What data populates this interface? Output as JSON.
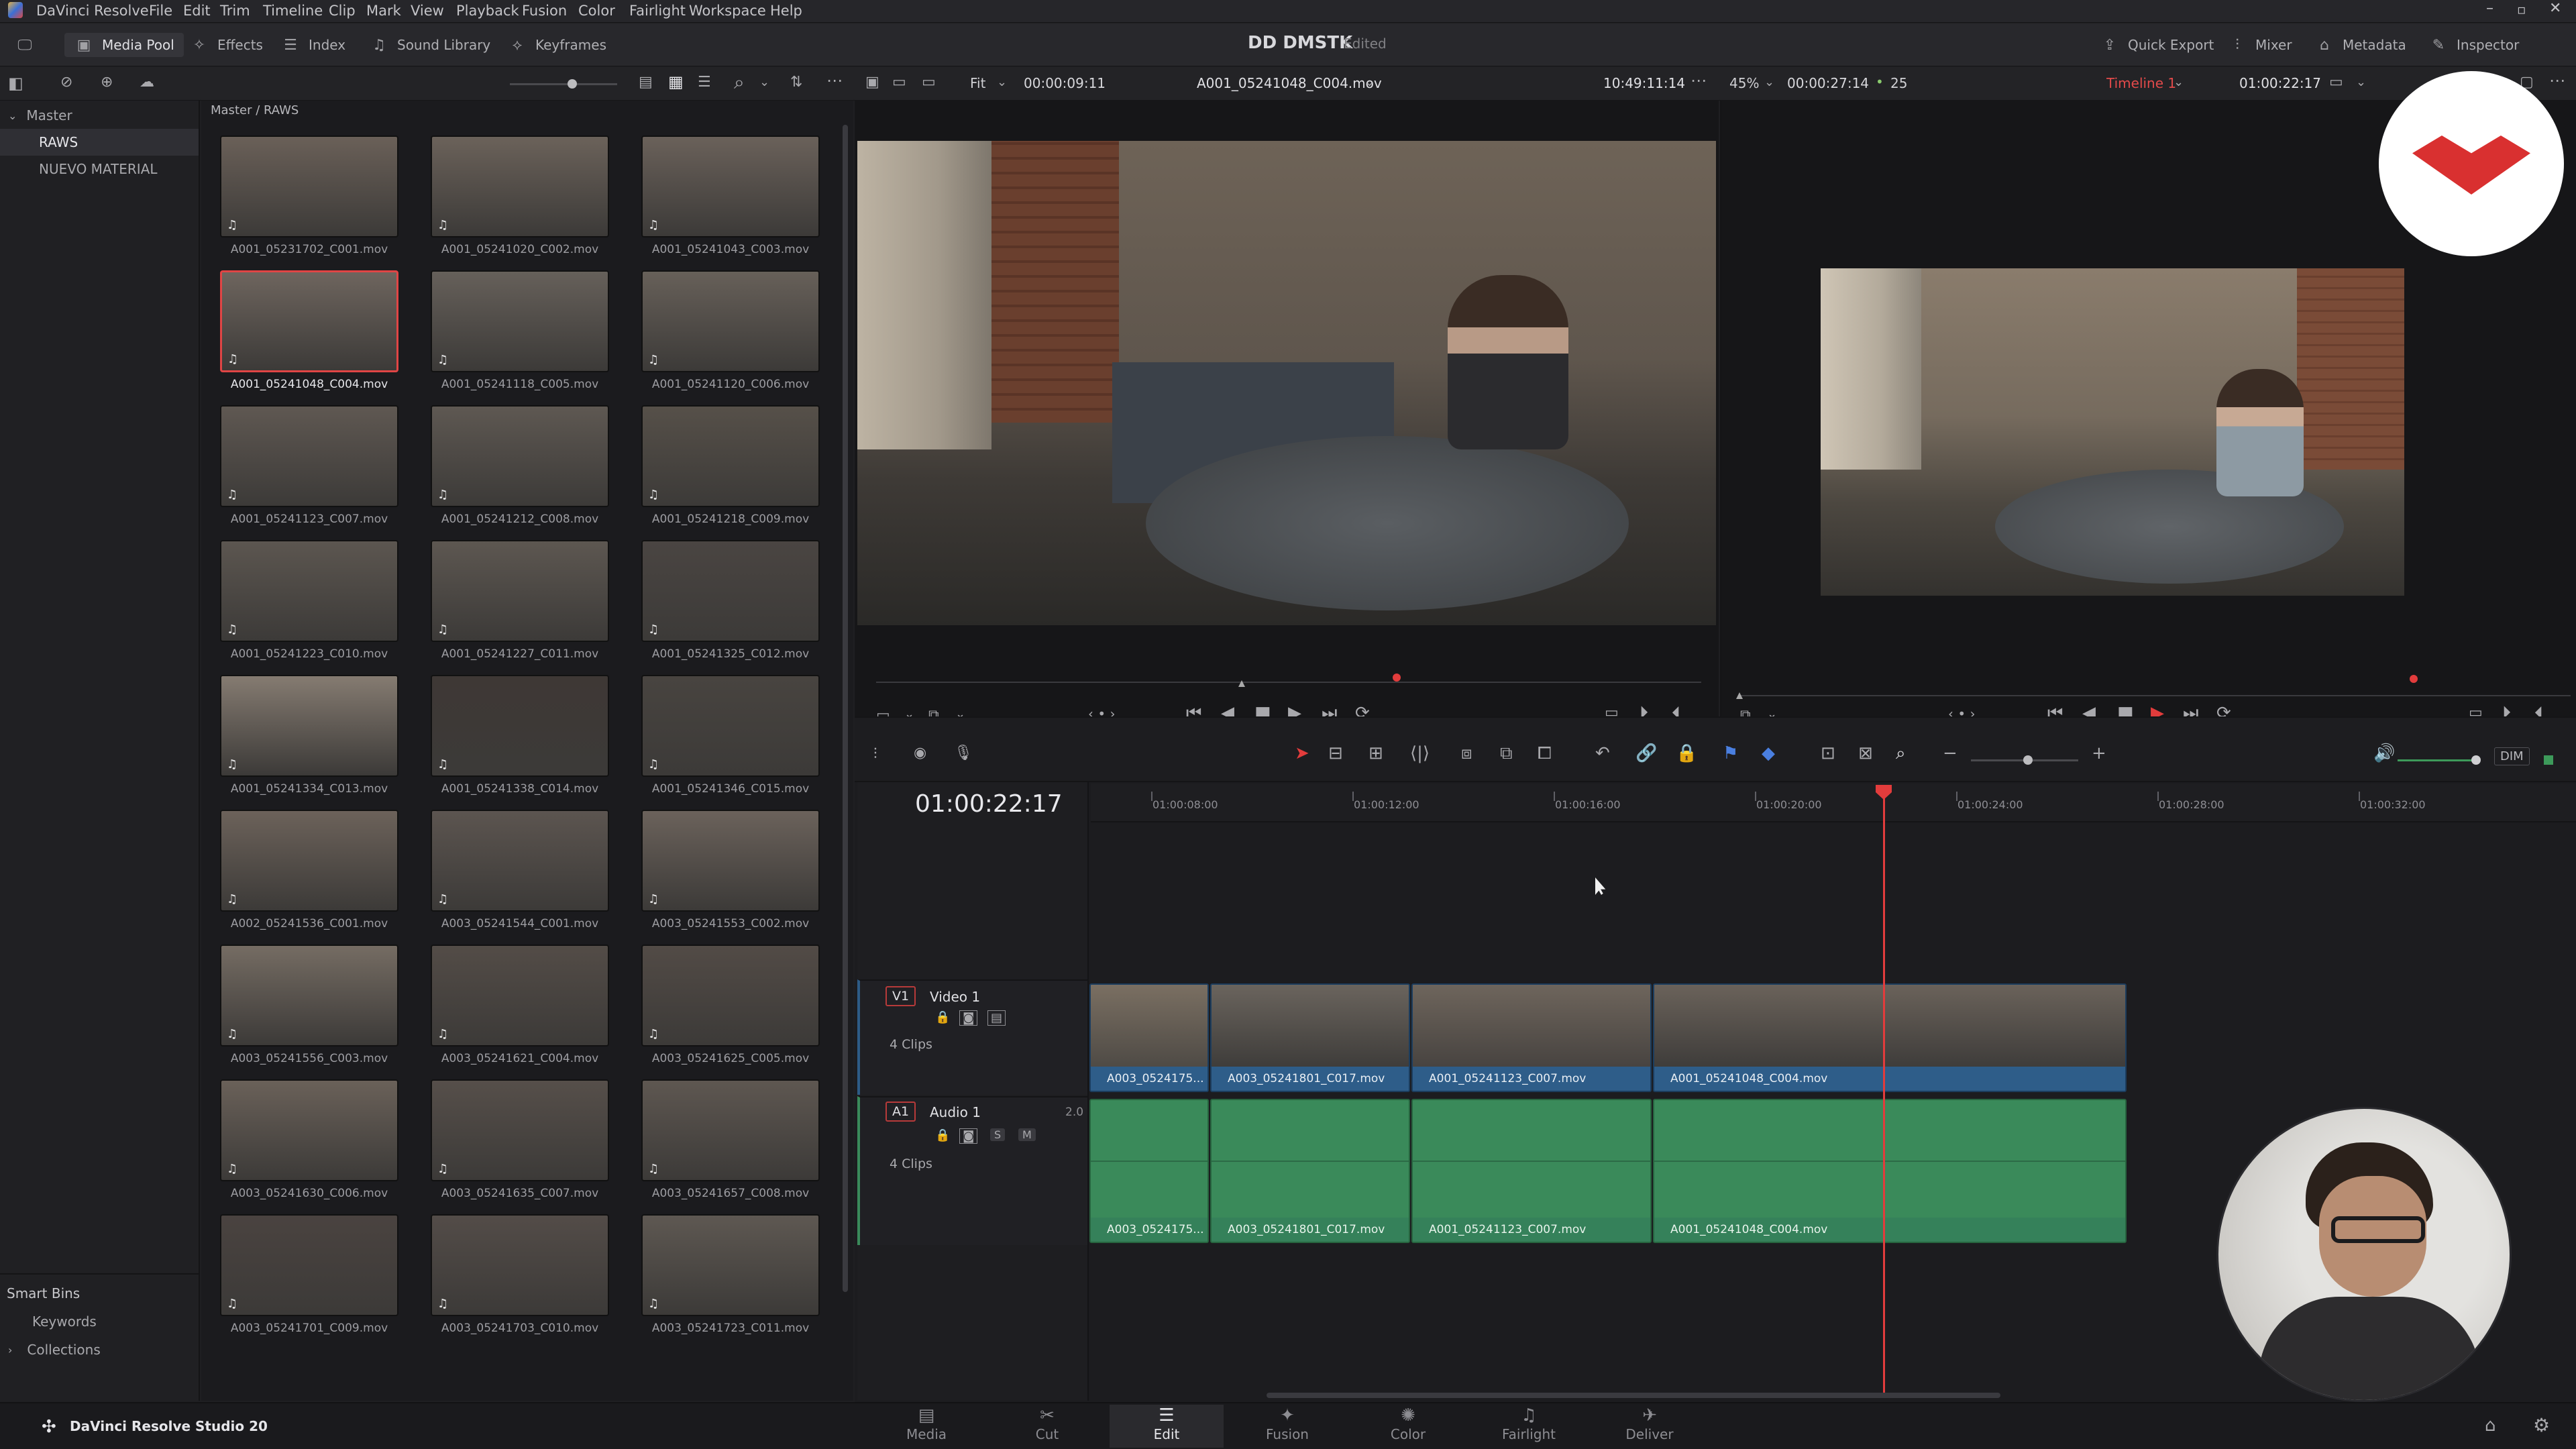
{
  "app": {
    "name": "DaVinci Resolve",
    "version_label": "DaVinci Resolve Studio 20"
  },
  "menu": [
    "File",
    "Edit",
    "Trim",
    "Timeline",
    "Clip",
    "Mark",
    "View",
    "Playback",
    "Fusion",
    "Color",
    "Fairlight",
    "Workspace",
    "Help"
  ],
  "toolbar": {
    "media_pool": "Media Pool",
    "effects": "Effects",
    "index": "Index",
    "sound_library": "Sound Library",
    "keyframes": "Keyframes",
    "project_name": "DD DMSTK",
    "project_status": "Edited",
    "quick_export": "Quick Export",
    "mixer": "Mixer",
    "metadata": "Metadata",
    "inspector": "Inspector"
  },
  "source_viewer": {
    "fit": "Fit",
    "duration": "00:00:09:11",
    "clip_name": "A001_05241048_C004.mov",
    "timecode": "10:49:11:14"
  },
  "timeline_viewer": {
    "zoom": "45%",
    "duration": "00:00:27:14",
    "fps": "25",
    "timeline_name": "Timeline 1",
    "timecode": "01:00:22:17"
  },
  "sidebar": {
    "master": "Master",
    "bins": [
      "RAWS",
      "NUEVO MATERIAL"
    ],
    "smart_bins": "Smart Bins",
    "smart_items": [
      "Keywords",
      "Collections"
    ]
  },
  "media_pool": {
    "breadcrumb": "Master / RAWS",
    "clips": [
      {
        "name": "A001_05231702_C001.mov",
        "tone": "#6a6058"
      },
      {
        "name": "A001_05241020_C002.mov",
        "tone": "#6b625a"
      },
      {
        "name": "A001_05241043_C003.mov",
        "tone": "#6a615a"
      },
      {
        "name": "A001_05241048_C004.mov",
        "tone": "#6e655e"
      },
      {
        "name": "A001_05241118_C005.mov",
        "tone": "#66605a"
      },
      {
        "name": "A001_05241120_C006.mov",
        "tone": "#676059"
      },
      {
        "name": "A001_05241123_C007.mov",
        "tone": "#5f5852"
      },
      {
        "name": "A001_05241212_C008.mov",
        "tone": "#5e5852"
      },
      {
        "name": "A001_05241218_C009.mov",
        "tone": "#565049"
      },
      {
        "name": "A001_05241223_C010.mov",
        "tone": "#5c5650"
      },
      {
        "name": "A001_05241227_C011.mov",
        "tone": "#5d5751"
      },
      {
        "name": "A001_05241325_C012.mov",
        "tone": "#4a4542"
      },
      {
        "name": "A001_05241334_C013.mov",
        "tone": "#857b71"
      },
      {
        "name": "A001_05241338_C014.mov",
        "tone": "#3e3835"
      },
      {
        "name": "A001_05241346_C015.mov",
        "tone": "#484440"
      },
      {
        "name": "A002_05241536_C001.mov",
        "tone": "#6c625a"
      },
      {
        "name": "A003_05241544_C001.mov",
        "tone": "#5c5550"
      },
      {
        "name": "A003_05241553_C002.mov",
        "tone": "#6b625b"
      },
      {
        "name": "A003_05241556_C003.mov",
        "tone": "#756c63"
      },
      {
        "name": "A003_05241621_C004.mov",
        "tone": "#534c47"
      },
      {
        "name": "A003_05241625_C005.mov",
        "tone": "#524b46"
      },
      {
        "name": "A003_05241630_C006.mov",
        "tone": "#6a6159"
      },
      {
        "name": "A003_05241635_C007.mov",
        "tone": "#564f4a"
      },
      {
        "name": "A003_05241657_C008.mov",
        "tone": "#5e5751"
      },
      {
        "name": "A003_05241701_C009.mov",
        "tone": "#4a4340"
      },
      {
        "name": "A003_05241703_C010.mov",
        "tone": "#534c48"
      },
      {
        "name": "A003_05241723_C011.mov",
        "tone": "#5e5852"
      }
    ]
  },
  "timeline": {
    "timecode": "01:00:22:17",
    "ruler": [
      "01:00:08:00",
      "01:00:12:00",
      "01:00:16:00",
      "01:00:20:00",
      "01:00:24:00",
      "01:00:28:00",
      "01:00:32:00"
    ],
    "video_track": {
      "id": "V1",
      "name": "Video 1",
      "count": "4 Clips"
    },
    "audio_track": {
      "id": "A1",
      "name": "Audio 1",
      "count": "4 Clips",
      "channels": "2.0",
      "solo": "S",
      "mute": "M"
    },
    "clips": [
      "A003_0524175...",
      "A003_05241801_C017.mov",
      "A001_05241123_C007.mov",
      "A001_05241048_C004.mov"
    ],
    "dim": "DIM"
  },
  "pages": [
    "Media",
    "Cut",
    "Edit",
    "Fusion",
    "Color",
    "Fairlight",
    "Deliver"
  ],
  "colors": {
    "playhead": "#e23c3c",
    "video_clip": "#2d5b86",
    "audio_clip": "#3a8a5a",
    "accent_red": "#d93030"
  }
}
